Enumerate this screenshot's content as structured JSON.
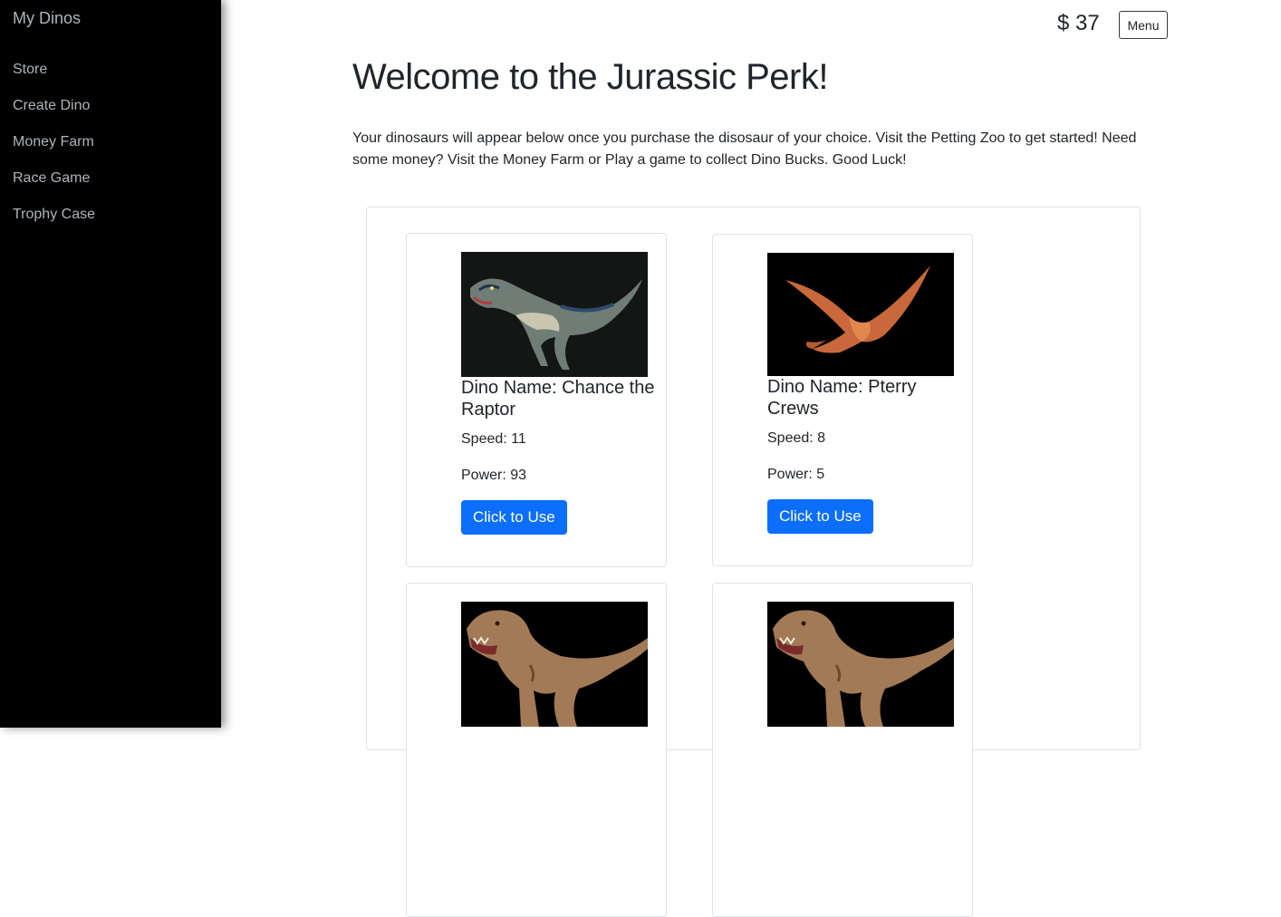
{
  "sidebar": {
    "title": "My Dinos",
    "items": [
      {
        "label": "Store"
      },
      {
        "label": "Create Dino"
      },
      {
        "label": "Money Farm"
      },
      {
        "label": "Race Game"
      },
      {
        "label": "Trophy Case"
      }
    ]
  },
  "header": {
    "money": "$ 37",
    "menu_label": "Menu"
  },
  "main": {
    "title": "Welcome to the Jurassic Perk!",
    "intro": "Your dinosaurs will appear below once you purchase the disosaur of your choice. Visit the Petting Zoo to get started! Need some money? Visit the Money Farm or Play a game to collect Dino Bucks. Good Luck!"
  },
  "cards": [
    {
      "name": "Dino Name: Chance the Raptor",
      "speed": "Speed: 11",
      "power": "Power: 93",
      "button": "Click to Use",
      "image": "raptor-image"
    },
    {
      "name": "Dino Name: Pterry Crews",
      "speed": "Speed: 8",
      "power": "Power: 5",
      "button": "Click to Use",
      "image": "pterodactyl-image"
    },
    {
      "name": "",
      "speed": "",
      "power": "",
      "button": "",
      "image": "trex-image"
    },
    {
      "name": "",
      "speed": "",
      "power": "",
      "button": "",
      "image": "trex-image"
    }
  ],
  "colors": {
    "sidebar_bg": "#000000",
    "sidebar_text": "#aeb4b9",
    "button_primary": "#0b6efd",
    "border": "#dee2e6"
  }
}
